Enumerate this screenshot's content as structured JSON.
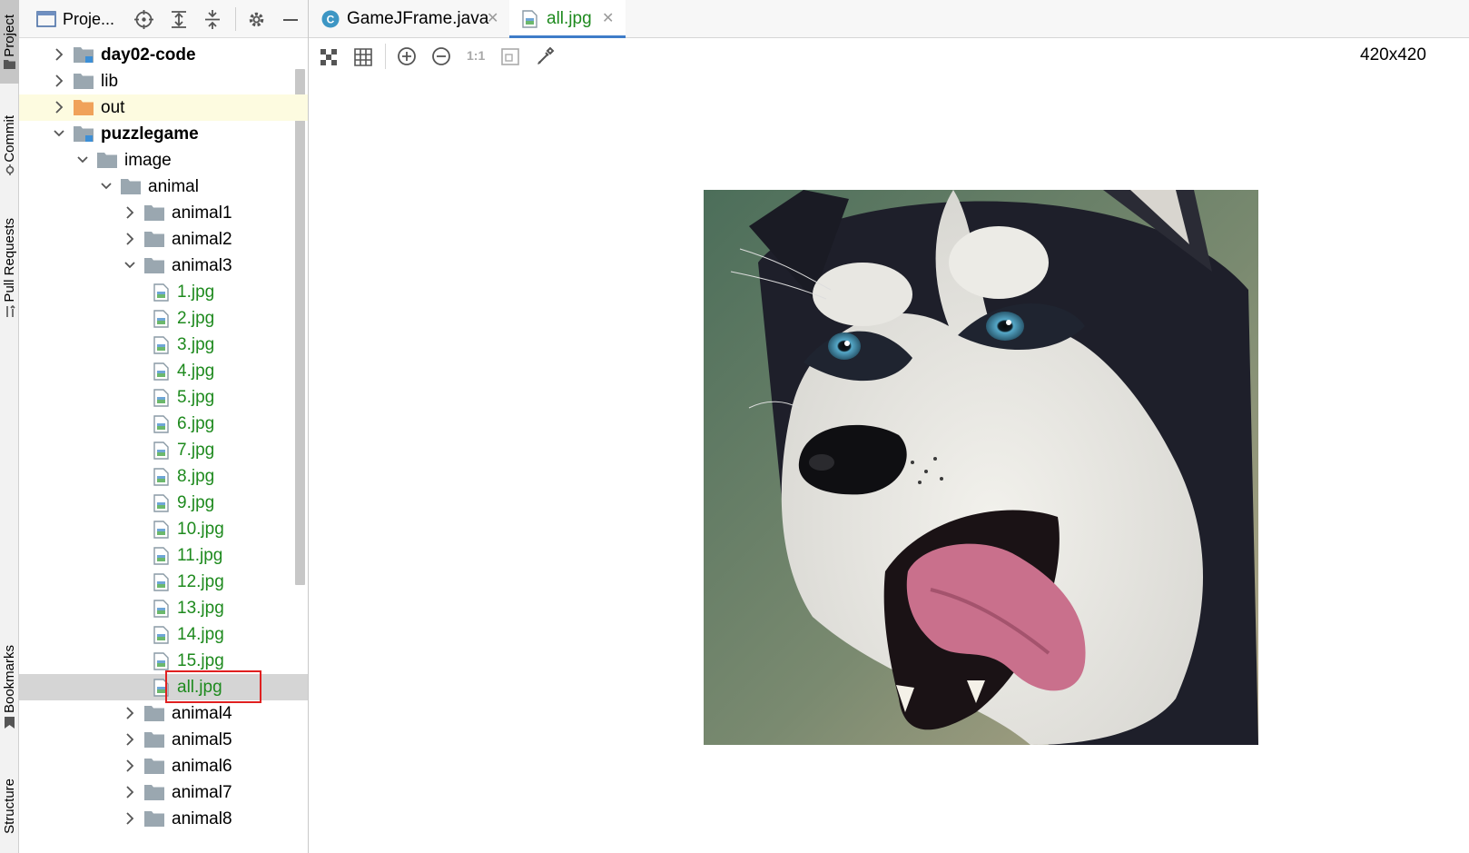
{
  "left_strip": {
    "project_label": "Project",
    "commit_label": "Commit",
    "pull_requests_label": "Pull Requests",
    "bookmarks_label": "Bookmarks",
    "structure_label": "Structure"
  },
  "project_panel": {
    "title": "Proje...",
    "tree": [
      {
        "label": "day02-code",
        "depth": 0,
        "expanded": false,
        "type": "module",
        "bold": true
      },
      {
        "label": "lib",
        "depth": 0,
        "expanded": false,
        "type": "folder"
      },
      {
        "label": "out",
        "depth": 0,
        "expanded": false,
        "type": "folder-orange"
      },
      {
        "label": "puzzlegame",
        "depth": 0,
        "expanded": true,
        "type": "module",
        "bold": true
      },
      {
        "label": "image",
        "depth": 1,
        "expanded": true,
        "type": "folder"
      },
      {
        "label": "animal",
        "depth": 2,
        "expanded": true,
        "type": "folder"
      },
      {
        "label": "animal1",
        "depth": 3,
        "expanded": false,
        "type": "folder"
      },
      {
        "label": "animal2",
        "depth": 3,
        "expanded": false,
        "type": "folder"
      },
      {
        "label": "animal3",
        "depth": 3,
        "expanded": true,
        "type": "folder"
      },
      {
        "label": "1.jpg",
        "depth": 4,
        "type": "image"
      },
      {
        "label": "2.jpg",
        "depth": 4,
        "type": "image"
      },
      {
        "label": "3.jpg",
        "depth": 4,
        "type": "image"
      },
      {
        "label": "4.jpg",
        "depth": 4,
        "type": "image"
      },
      {
        "label": "5.jpg",
        "depth": 4,
        "type": "image"
      },
      {
        "label": "6.jpg",
        "depth": 4,
        "type": "image"
      },
      {
        "label": "7.jpg",
        "depth": 4,
        "type": "image"
      },
      {
        "label": "8.jpg",
        "depth": 4,
        "type": "image"
      },
      {
        "label": "9.jpg",
        "depth": 4,
        "type": "image"
      },
      {
        "label": "10.jpg",
        "depth": 4,
        "type": "image"
      },
      {
        "label": "11.jpg",
        "depth": 4,
        "type": "image"
      },
      {
        "label": "12.jpg",
        "depth": 4,
        "type": "image"
      },
      {
        "label": "13.jpg",
        "depth": 4,
        "type": "image"
      },
      {
        "label": "14.jpg",
        "depth": 4,
        "type": "image"
      },
      {
        "label": "15.jpg",
        "depth": 4,
        "type": "image"
      },
      {
        "label": "all.jpg",
        "depth": 4,
        "type": "image",
        "selected": true
      },
      {
        "label": "animal4",
        "depth": 3,
        "expanded": false,
        "type": "folder"
      },
      {
        "label": "animal5",
        "depth": 3,
        "expanded": false,
        "type": "folder"
      },
      {
        "label": "animal6",
        "depth": 3,
        "expanded": false,
        "type": "folder"
      },
      {
        "label": "animal7",
        "depth": 3,
        "expanded": false,
        "type": "folder"
      },
      {
        "label": "animal8",
        "depth": 3,
        "expanded": false,
        "type": "folder"
      }
    ]
  },
  "editor": {
    "tabs": [
      {
        "label": "GameJFrame.java",
        "icon": "java-class-icon",
        "active": false
      },
      {
        "label": "all.jpg",
        "icon": "image-file-icon",
        "active": true
      }
    ],
    "toolbar": {
      "actual_size_label": "1:1",
      "image_dimensions": "420x420"
    }
  },
  "colors": {
    "accent": "#3e7cc8",
    "file_green": "#1e8a1e",
    "selection_box": "#e02020",
    "folder_gray": "#9aa7b0",
    "folder_orange": "#f0a25a"
  }
}
